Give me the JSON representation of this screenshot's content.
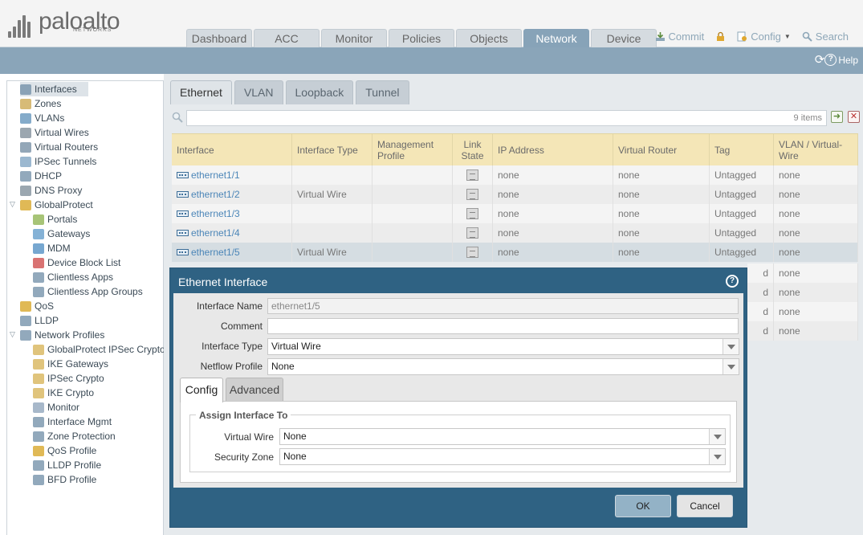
{
  "brand": {
    "name": "paloalto",
    "sub": "NETWORKS"
  },
  "main_tabs": [
    {
      "label": "Dashboard"
    },
    {
      "label": "ACC"
    },
    {
      "label": "Monitor"
    },
    {
      "label": "Policies"
    },
    {
      "label": "Objects"
    },
    {
      "label": "Network",
      "active": true
    },
    {
      "label": "Device"
    }
  ],
  "top_actions": {
    "commit": "Commit",
    "config": "Config",
    "search": "Search"
  },
  "help_label": "Help",
  "sidebar": {
    "items": [
      {
        "label": "Interfaces",
        "icon": "interfaces-icon",
        "selected": true
      },
      {
        "label": "Zones",
        "icon": "zones-icon"
      },
      {
        "label": "VLANs",
        "icon": "vlans-icon"
      },
      {
        "label": "Virtual Wires",
        "icon": "virtual-wires-icon"
      },
      {
        "label": "Virtual Routers",
        "icon": "virtual-routers-icon"
      },
      {
        "label": "IPSec Tunnels",
        "icon": "ipsec-tunnels-icon"
      },
      {
        "label": "DHCP",
        "icon": "dhcp-icon"
      },
      {
        "label": "DNS Proxy",
        "icon": "dns-proxy-icon"
      },
      {
        "label": "GlobalProtect",
        "icon": "globalprotect-icon"
      },
      {
        "label": "Portals",
        "icon": "portals-icon"
      },
      {
        "label": "Gateways",
        "icon": "gateways-icon"
      },
      {
        "label": "MDM",
        "icon": "mdm-icon"
      },
      {
        "label": "Device Block List",
        "icon": "device-block-list-icon"
      },
      {
        "label": "Clientless Apps",
        "icon": "clientless-apps-icon"
      },
      {
        "label": "Clientless App Groups",
        "icon": "clientless-app-groups-icon"
      },
      {
        "label": "QoS",
        "icon": "qos-icon"
      },
      {
        "label": "LLDP",
        "icon": "lldp-icon"
      },
      {
        "label": "Network Profiles",
        "icon": "network-profiles-icon"
      },
      {
        "label": "GlobalProtect IPSec Crypto",
        "icon": "lock-icon"
      },
      {
        "label": "IKE Gateways",
        "icon": "lock-icon"
      },
      {
        "label": "IPSec Crypto",
        "icon": "lock-icon"
      },
      {
        "label": "IKE Crypto",
        "icon": "lock-icon"
      },
      {
        "label": "Monitor",
        "icon": "monitor-profile-icon"
      },
      {
        "label": "Interface Mgmt",
        "icon": "interface-mgmt-icon"
      },
      {
        "label": "Zone Protection",
        "icon": "zone-protection-icon"
      },
      {
        "label": "QoS Profile",
        "icon": "qos-profile-icon"
      },
      {
        "label": "LLDP Profile",
        "icon": "lldp-profile-icon"
      },
      {
        "label": "BFD Profile",
        "icon": "bfd-profile-icon"
      }
    ]
  },
  "sub_tabs": [
    {
      "label": "Ethernet",
      "active": true
    },
    {
      "label": "VLAN"
    },
    {
      "label": "Loopback"
    },
    {
      "label": "Tunnel"
    }
  ],
  "filter": {
    "count": "9 items"
  },
  "grid": {
    "headers": [
      "Interface",
      "Interface Type",
      "Management Profile",
      "Link State",
      "IP Address",
      "Virtual Router",
      "Tag",
      "VLAN / Virtual-Wire"
    ],
    "rows": [
      {
        "name": "ethernet1/1",
        "type": "",
        "mgmt": "",
        "ip": "none",
        "vr": "none",
        "tag": "Untagged",
        "vlan": "none"
      },
      {
        "name": "ethernet1/2",
        "type": "Virtual Wire",
        "mgmt": "",
        "ip": "none",
        "vr": "none",
        "tag": "Untagged",
        "vlan": "none"
      },
      {
        "name": "ethernet1/3",
        "type": "",
        "mgmt": "",
        "ip": "none",
        "vr": "none",
        "tag": "Untagged",
        "vlan": "none"
      },
      {
        "name": "ethernet1/4",
        "type": "",
        "mgmt": "",
        "ip": "none",
        "vr": "none",
        "tag": "Untagged",
        "vlan": "none"
      },
      {
        "name": "ethernet1/5",
        "type": "Virtual Wire",
        "mgmt": "",
        "ip": "none",
        "vr": "none",
        "tag": "Untagged",
        "vlan": "none",
        "selected": true
      }
    ],
    "hidden_rows_partial": [
      {
        "tag": "d",
        "vlan": "none"
      },
      {
        "tag": "d",
        "vlan": "none"
      },
      {
        "tag": "d",
        "vlan": "none"
      },
      {
        "tag": "d",
        "vlan": "none"
      }
    ]
  },
  "modal": {
    "title": "Ethernet Interface",
    "fields": {
      "interface_name_label": "Interface Name",
      "interface_name_value": "ethernet1/5",
      "comment_label": "Comment",
      "comment_value": "",
      "interface_type_label": "Interface Type",
      "interface_type_value": "Virtual Wire",
      "netflow_label": "Netflow Profile",
      "netflow_value": "None"
    },
    "tabs": [
      {
        "label": "Config",
        "active": true
      },
      {
        "label": "Advanced"
      }
    ],
    "fieldset": {
      "legend": "Assign Interface To",
      "virtual_wire_label": "Virtual Wire",
      "virtual_wire_value": "None",
      "security_zone_label": "Security Zone",
      "security_zone_value": "None"
    },
    "buttons": {
      "ok": "OK",
      "cancel": "Cancel"
    }
  },
  "colors": {
    "accent": "#87a3b8",
    "modal": "#2f6283",
    "grid_header": "#f4e6b7",
    "link": "#4c86b8"
  }
}
